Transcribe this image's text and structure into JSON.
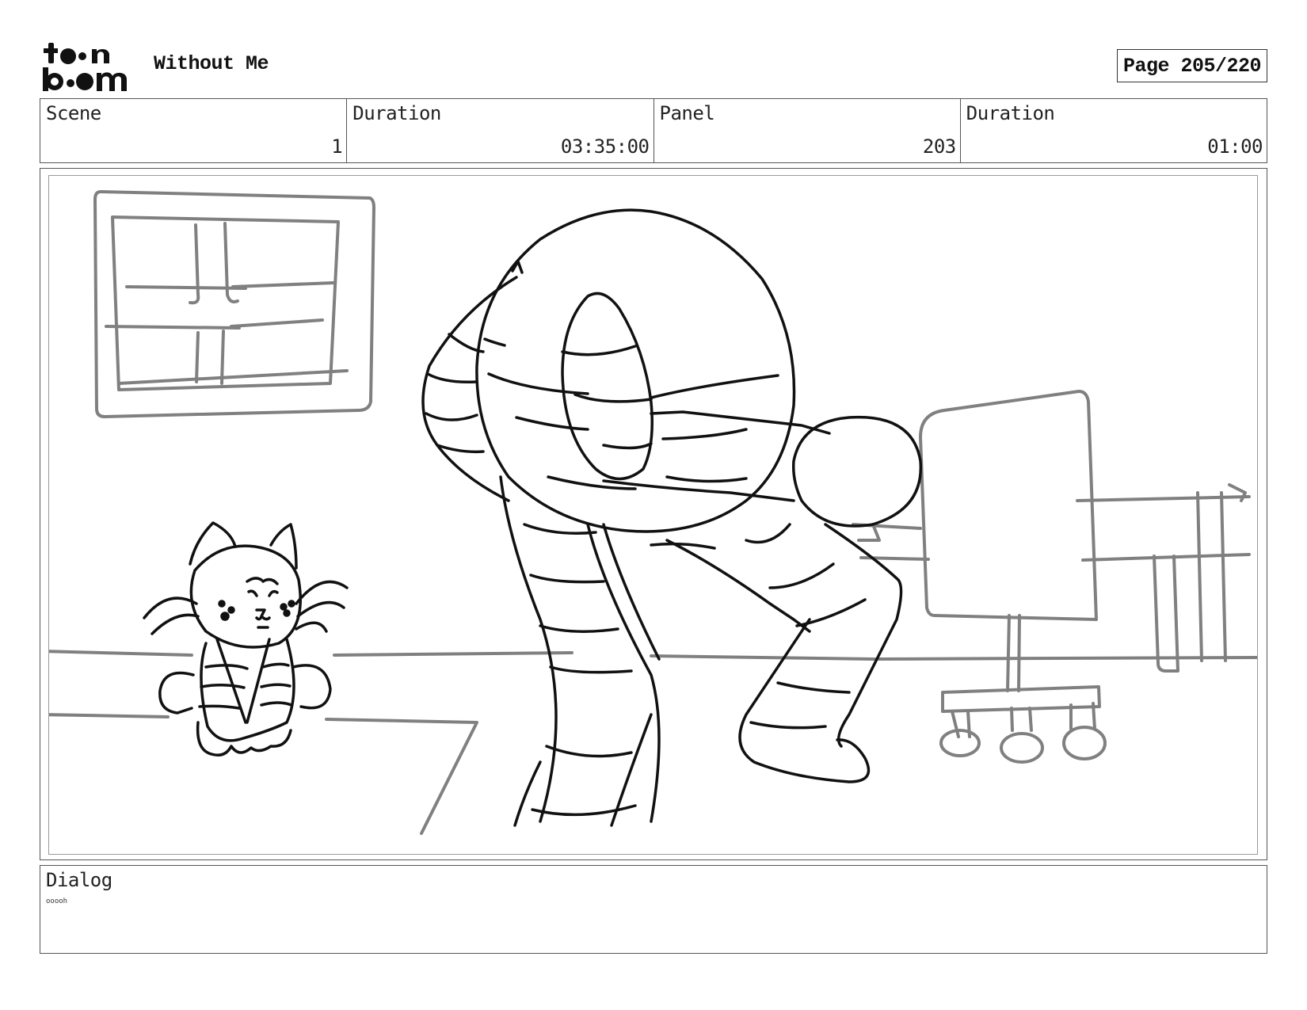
{
  "header": {
    "logo_text": "toon boom",
    "title": "Without Me",
    "page_label": "Page 205/220"
  },
  "info": {
    "scene_label": "Scene",
    "scene_value": "1",
    "scene_duration_label": "Duration",
    "scene_duration_value": "03:35:00",
    "panel_label": "Panel",
    "panel_value": "203",
    "panel_duration_label": "Duration",
    "panel_duration_value": "01:00"
  },
  "dialog": {
    "label": "Dialog",
    "text": "ooooh"
  },
  "colors": {
    "ink": "#111111",
    "background_sketch": "#808080",
    "frame": "#555555"
  }
}
